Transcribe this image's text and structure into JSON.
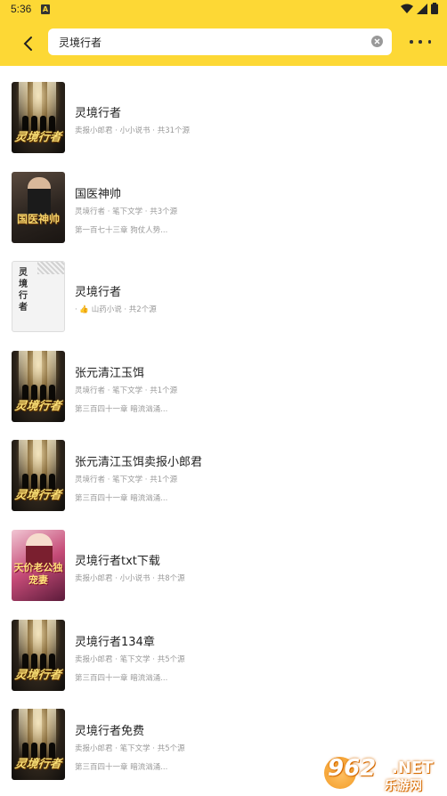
{
  "status_bar": {
    "time": "5:36",
    "notification_letter": "A"
  },
  "toolbar": {
    "search_value": "灵境行者"
  },
  "results": [
    {
      "title": "灵境行者",
      "meta": "卖报小郎君 · 小小说书 · 共31个源",
      "latest": "",
      "cover": "dark",
      "cover_title": "灵境行者"
    },
    {
      "title": "国医神帅",
      "meta": "灵境行者 · 笔下文学 · 共3个源",
      "latest": "第一百七十三章 狗仗人势...",
      "cover": "doctor",
      "cover_title": "国医神帅"
    },
    {
      "title": "灵境行者",
      "meta": "· 👍 山药小说 · 共2个源",
      "latest": "",
      "cover": "plain",
      "cover_title": "灵境行者"
    },
    {
      "title": "张元清江玉饵",
      "meta": "灵境行者 · 笔下文学 · 共1个源",
      "latest": "第三百四十一章 暗流汹涌...",
      "cover": "dark",
      "cover_title": "灵境行者"
    },
    {
      "title": "张元清江玉饵卖报小郎君",
      "meta": "灵境行者 · 笔下文学 · 共1个源",
      "latest": "第三百四十一章 暗流汹涌...",
      "cover": "dark",
      "cover_title": "灵境行者"
    },
    {
      "title": "灵境行者txt下载",
      "meta": "卖报小郎君 · 小小说书 · 共8个源",
      "latest": "",
      "cover": "romance",
      "cover_title": "天价老公独宠妻"
    },
    {
      "title": "灵境行者134章",
      "meta": "卖报小郎君 · 笔下文学 · 共5个源",
      "latest": "第三百四十一章 暗流汹涌...",
      "cover": "dark",
      "cover_title": "灵境行者"
    },
    {
      "title": "灵境行者免费",
      "meta": "卖报小郎君 · 笔下文学 · 共5个源",
      "latest": "第三百四十一章 暗流汹涌...",
      "cover": "dark",
      "cover_title": "灵境行者"
    }
  ],
  "watermark": {
    "number": "962",
    "suffix": ".NET",
    "site": "乐游网"
  },
  "colors": {
    "toolbar": "#fdd835",
    "title_text": "#222222",
    "meta_text": "#999999"
  }
}
